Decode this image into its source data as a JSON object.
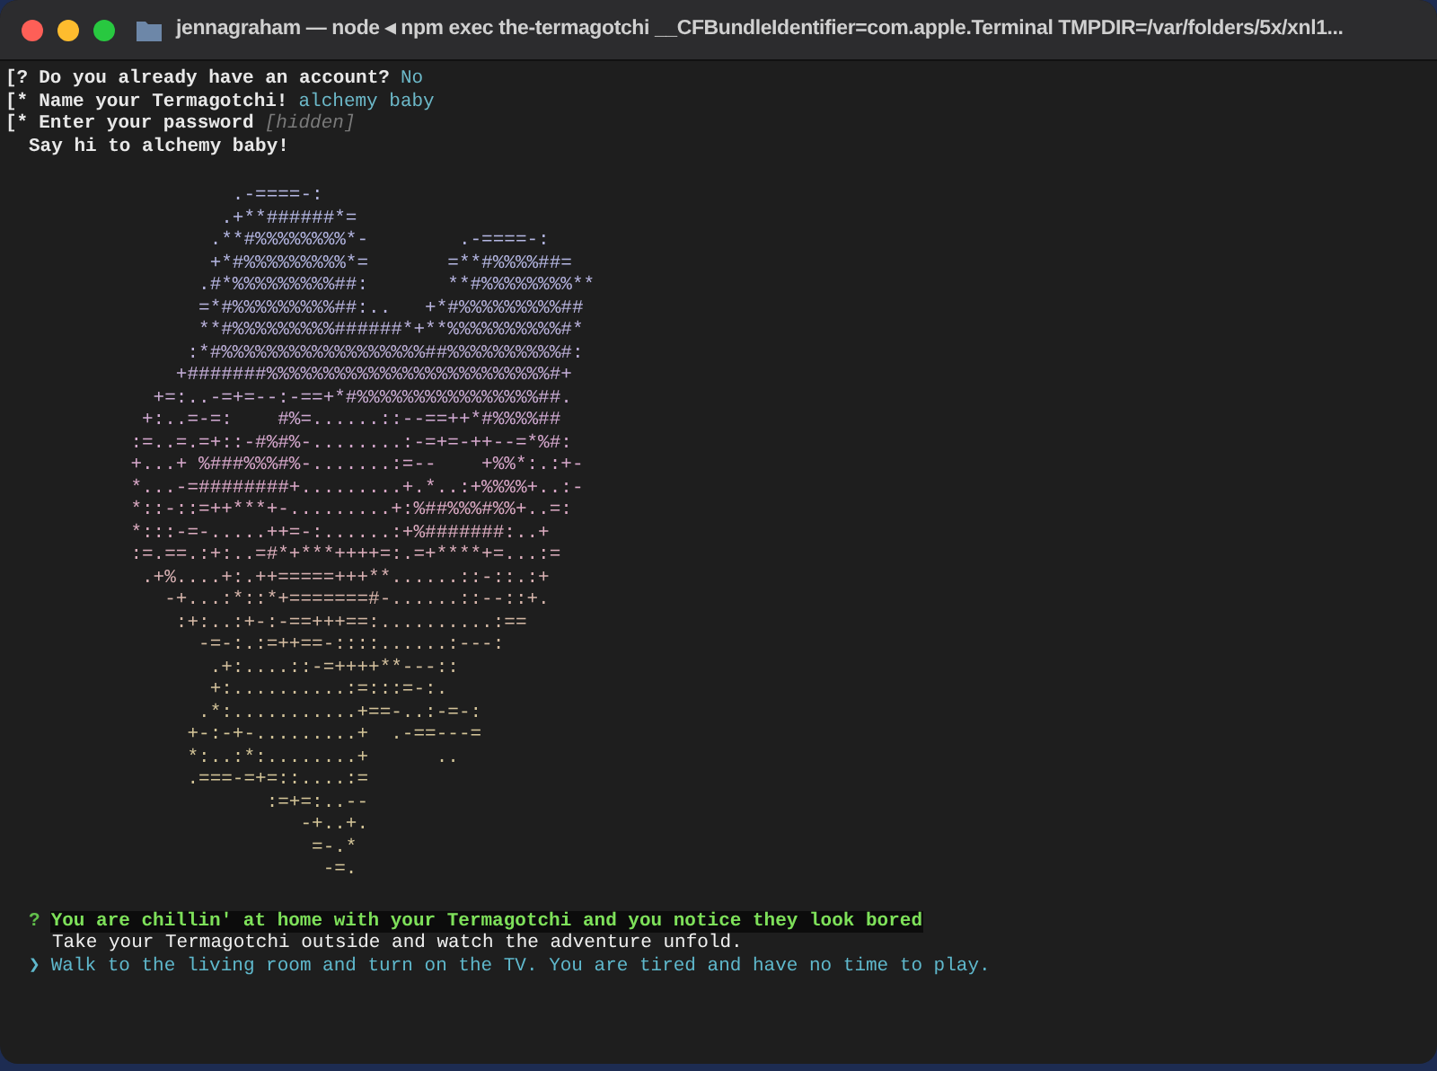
{
  "window": {
    "title": "jennagraham — node ◂ npm exec the-termagotchi __CFBundleIdentifier=com.apple.Terminal TMPDIR=/var/folders/5x/xnl1..."
  },
  "prompts": [
    {
      "prefix": "[?",
      "question": "Do you already have an account?",
      "answer": "No",
      "kind": "answer"
    },
    {
      "prefix": "[*",
      "question": "Name your Termagotchi!",
      "answer": "alchemy baby",
      "kind": "answer"
    },
    {
      "prefix": "[*",
      "question": "Enter your password",
      "answer": "[hidden]",
      "kind": "hint"
    }
  ],
  "greeting": "Say hi to alchemy baby!",
  "art": {
    "lines": [
      {
        "text": "                  .-====-:",
        "color": "#b4b6e2"
      },
      {
        "text": "                 .+**######*=",
        "color": "#b4b6e2"
      },
      {
        "text": "                .**#%%%%%%%%*-        .-====-:",
        "color": "#b4b6e2"
      },
      {
        "text": "                +*#%%%%%%%%%*=       =**#%%%%##=",
        "color": "#b4b6e2"
      },
      {
        "text": "               .#*%%%%%%%%%##:       **#%%%%%%%%**",
        "color": "#b6b4e0"
      },
      {
        "text": "               =*#%%%%%%%%%##:..   +*#%%%%%%%%%##",
        "color": "#b8b4de"
      },
      {
        "text": "               **#%%%%%%%%%######*+**%%%%%%%%%%#*",
        "color": "#bab2dc"
      },
      {
        "text": "              :*#%%%%%%%%%%%%%%%%%%##%%%%%%%%%%#:",
        "color": "#beb0da"
      },
      {
        "text": "             +#######%%%%%%%%%%%%%%%%%%%%%%%%%#+",
        "color": "#c4aed8"
      },
      {
        "text": "           +=:..-=+=--:-==+*#%%%%%%%%%%%%%%%%##.",
        "color": "#caacd4"
      },
      {
        "text": "          +:..=-=:    #%=......::--==++*#%%%%##",
        "color": "#d0aad2"
      },
      {
        "text": "         :=..=.=+::-#%#%-........:-=+=-++--=*%#:",
        "color": "#d6a8ce"
      },
      {
        "text": "         +...+ %###%%%#%-.......:=--    +%%*:.:+-",
        "color": "#d8a8cc"
      },
      {
        "text": "         *...-=########+.........+.*..:+%%%%+..:-",
        "color": "#daa8c8"
      },
      {
        "text": "         *::-::=++***+-.........+:%##%%%#%%+..=:",
        "color": "#dcaac4"
      },
      {
        "text": "         *:::-=-.....++=-:......:+%#######:..+",
        "color": "#dcacc0"
      },
      {
        "text": "         :=.==.:+:..=#*+***++++=:.=+****+=...:=",
        "color": "#dcaebc"
      },
      {
        "text": "          .+%....+:.++=====+++**......::-::.:+",
        "color": "#dab2b4"
      },
      {
        "text": "            -+...:*::*+=======#-......::--::+.",
        "color": "#d8b6ac"
      },
      {
        "text": "             :+:..:+-:-==+++==:..........:==",
        "color": "#d6baa6"
      },
      {
        "text": "               -=-:.:=++==-::::......:---:",
        "color": "#d6bea2"
      },
      {
        "text": "                .+:....::-=++++**---::",
        "color": "#d4c09e"
      },
      {
        "text": "                +:..........:=:::=-:.",
        "color": "#d4c29c"
      },
      {
        "text": "               .*:...........+==-..:-=-:",
        "color": "#d4c49a"
      },
      {
        "text": "              +-:-+-.........+  .-==---=",
        "color": "#d4c598"
      },
      {
        "text": "              *:..:*:........+      ..",
        "color": "#d4c598"
      },
      {
        "text": "              .===-=+=::....:=",
        "color": "#d4c598"
      },
      {
        "text": "                     :=+=:..--",
        "color": "#d4c598"
      },
      {
        "text": "                        -+..+.",
        "color": "#d4c598"
      },
      {
        "text": "                         =-.*",
        "color": "#d4c598"
      },
      {
        "text": "                          -=.",
        "color": "#d4c598"
      }
    ]
  },
  "question": {
    "mark": "?",
    "text": "You are chillin' at home with your Termagotchi and you notice they look bored",
    "hint": "Take your Termagotchi outside and watch the adventure unfold."
  },
  "choices": [
    {
      "pointer": "❯",
      "text": "Walk to the living room and turn on the TV. You are tired and have no time to play.",
      "selected": true
    }
  ]
}
